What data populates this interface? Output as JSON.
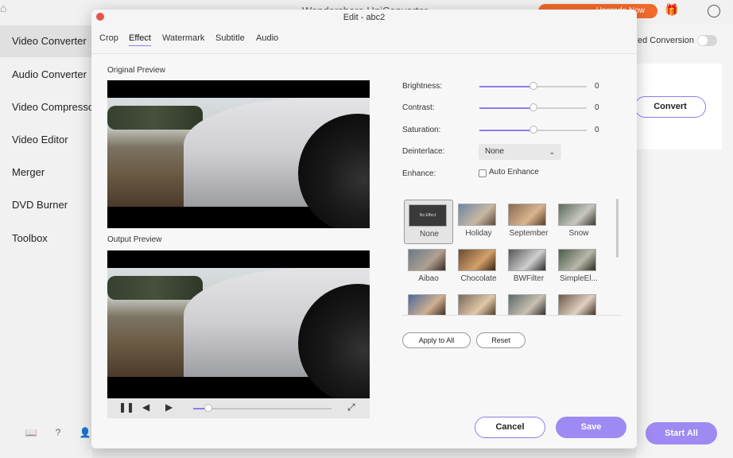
{
  "app": {
    "title": "Wondershare UniConverter",
    "promo": "Upgrade Now",
    "hi_conversion": "ed Conversion",
    "convert": "Convert",
    "start_all": "Start All"
  },
  "sidebar": {
    "items": [
      {
        "label": "Video Converter",
        "active": true
      },
      {
        "label": "Audio Converter"
      },
      {
        "label": "Video Compressor"
      },
      {
        "label": "Video Editor"
      },
      {
        "label": "Merger"
      },
      {
        "label": "DVD Burner"
      },
      {
        "label": "Toolbox"
      }
    ],
    "footer_icons": [
      "book-icon",
      "help-icon",
      "account-icon"
    ]
  },
  "dialog": {
    "title": "Edit - abc2",
    "tabs": [
      "Crop",
      "Effect",
      "Watermark",
      "Subtitle",
      "Audio"
    ],
    "active_tab": "Effect",
    "original_preview": "Original Preview",
    "output_preview": "Output Preview",
    "playback_progress": 0.11,
    "settings": {
      "brightness": {
        "label": "Brightness:",
        "value": "0",
        "level": 0.5
      },
      "contrast": {
        "label": "Contrast:",
        "value": "0",
        "level": 0.5
      },
      "saturation": {
        "label": "Saturation:",
        "value": "0",
        "level": 0.5
      },
      "deinterlace": {
        "label": "Deinterlace:",
        "selected": "None"
      },
      "enhance": {
        "label": "Enhance:",
        "checkbox_label": "Auto Enhance",
        "checked": false
      }
    },
    "effects": [
      "None",
      "Holiday",
      "September",
      "Snow",
      "Aibao",
      "Chocolate",
      "BWFilter",
      "SimpleEl...",
      "",
      "",
      "",
      ""
    ],
    "selected_effect": "None",
    "buttons": {
      "apply_all": "Apply to All",
      "reset": "Reset",
      "cancel": "Cancel",
      "save": "Save"
    }
  }
}
